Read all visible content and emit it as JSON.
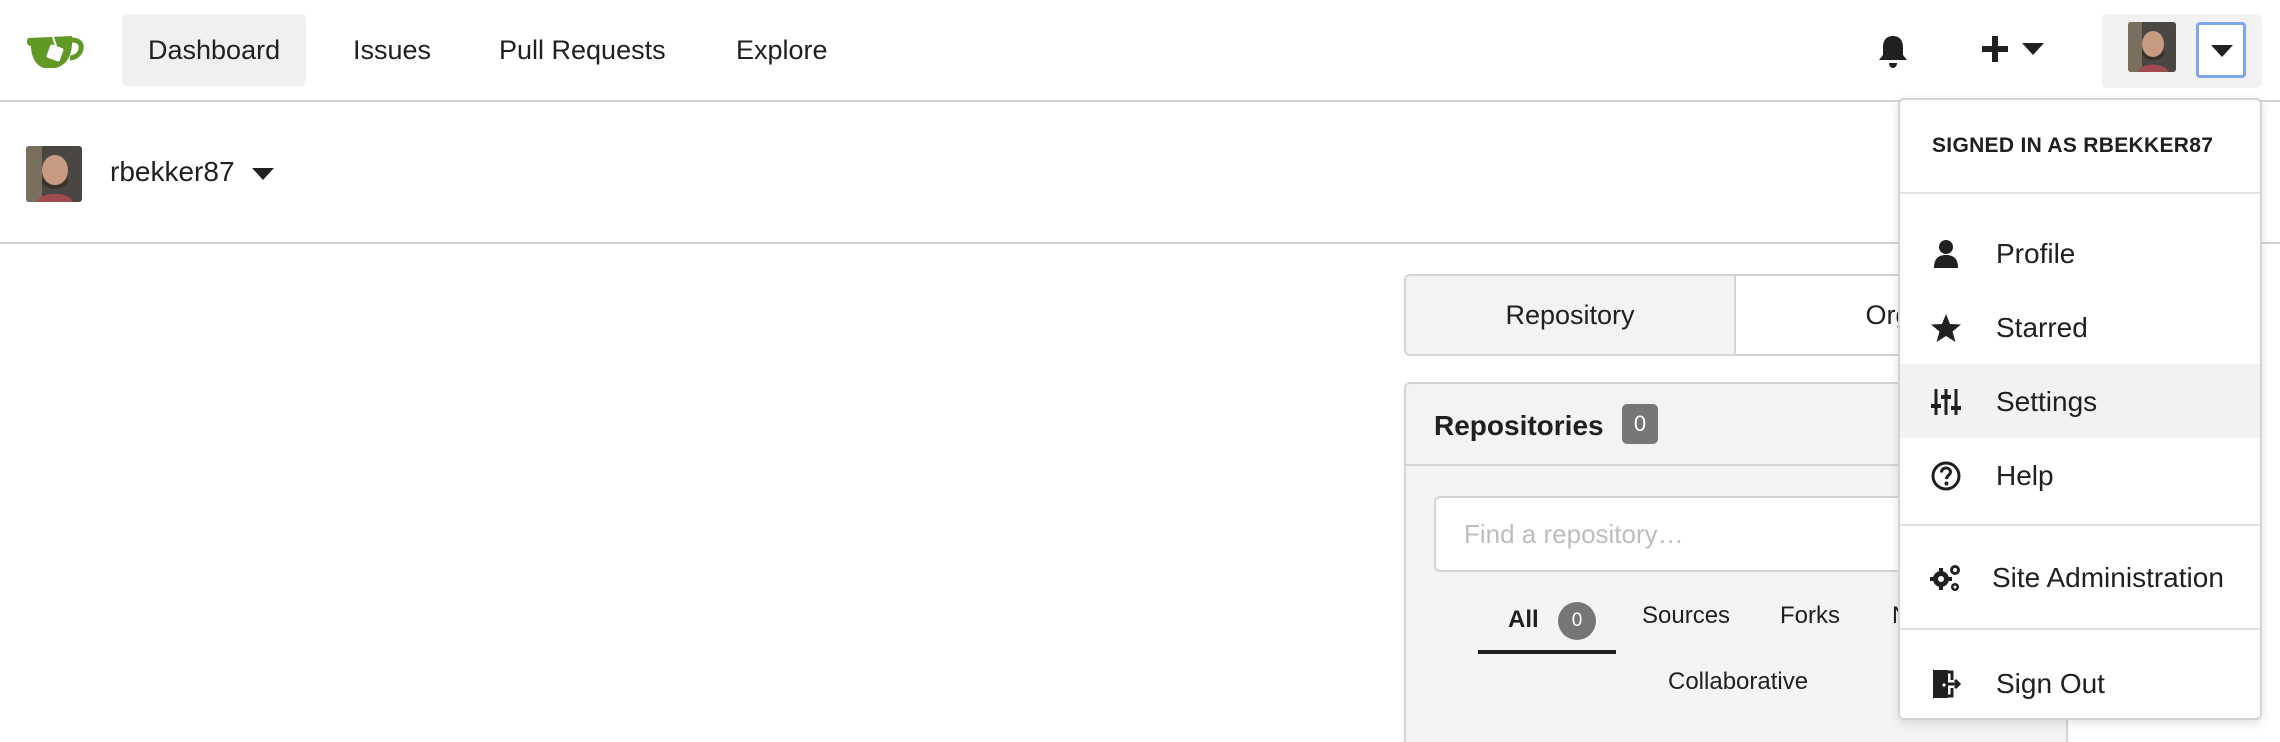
{
  "navbar": {
    "items": [
      {
        "label": "Dashboard",
        "active": true
      },
      {
        "label": "Issues",
        "active": false
      },
      {
        "label": "Pull Requests",
        "active": false
      },
      {
        "label": "Explore",
        "active": false
      }
    ],
    "brand_color": "#609926",
    "focus_ring_color": "#7da7ec"
  },
  "context": {
    "username": "rbekker87"
  },
  "tabs": {
    "repository": "Repository",
    "organization": "Organ"
  },
  "repos": {
    "title": "Repositories",
    "count": "0",
    "search_placeholder": "Find a repository…",
    "filters": {
      "all": "All",
      "all_count": "0",
      "sources": "Sources",
      "forks": "Forks",
      "mirrors": "N",
      "collaborative": "Collaborative"
    }
  },
  "user_dropdown": {
    "header": "SIGNED IN AS RBEKKER87",
    "items": [
      {
        "label": "Profile",
        "icon": "person-icon"
      },
      {
        "label": "Starred",
        "icon": "star-icon"
      },
      {
        "label": "Settings",
        "icon": "settings-sliders-icon",
        "hovered": true
      },
      {
        "label": "Help",
        "icon": "help-circle-icon"
      },
      {
        "label": "Site Administration",
        "icon": "gears-icon"
      },
      {
        "label": "Sign Out",
        "icon": "sign-out-icon"
      }
    ]
  }
}
